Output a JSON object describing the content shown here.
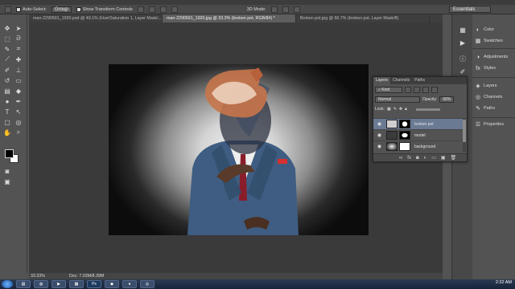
{
  "app": {
    "name": "Adobe Photoshop"
  },
  "options_bar": {
    "auto_select_label": "Auto-Select:",
    "auto_select_value": "Group",
    "transform_label": "Show Transform Controls",
    "mode_3d_label": "3D Mode:",
    "workspace": "Essentials"
  },
  "tabs": [
    {
      "label": "man-2290591_1920.psd @ 49.1% (Hue/Saturation 1, Layer Mask/..."
    },
    {
      "label": "man-2290591_1920.jpg @ 33.3% (broken pot, RGB/8#) *"
    },
    {
      "label": "Broken pot.jpg @ 66.7% (broken pot, Layer Mask/8)"
    }
  ],
  "status": {
    "zoom": "33.33%",
    "doc": "Doc: 7.03M/8.39M"
  },
  "layers_panel": {
    "tabs": [
      "Layers",
      "Channels",
      "Paths"
    ],
    "filter": "Kind",
    "blend_mode": "Normal",
    "opacity_label": "Opacity:",
    "opacity_value": "68%",
    "lock_label": "Lock:",
    "layers": [
      {
        "name": "broken pot"
      },
      {
        "name": "model"
      },
      {
        "name": "background"
      }
    ]
  },
  "right_panels": [
    {
      "label": "Color",
      "icon": "color-icon"
    },
    {
      "label": "Swatches",
      "icon": "swatches-icon"
    },
    {
      "label": "Adjustments",
      "icon": "adjustments-icon"
    },
    {
      "label": "Styles",
      "icon": "styles-icon"
    },
    {
      "label": "Layers",
      "icon": "layers-icon"
    },
    {
      "label": "Channels",
      "icon": "channels-icon"
    },
    {
      "label": "Paths",
      "icon": "paths-icon"
    },
    {
      "label": "Properties",
      "icon": "properties-icon"
    }
  ],
  "taskbar": {
    "time": "2:32 AM"
  }
}
